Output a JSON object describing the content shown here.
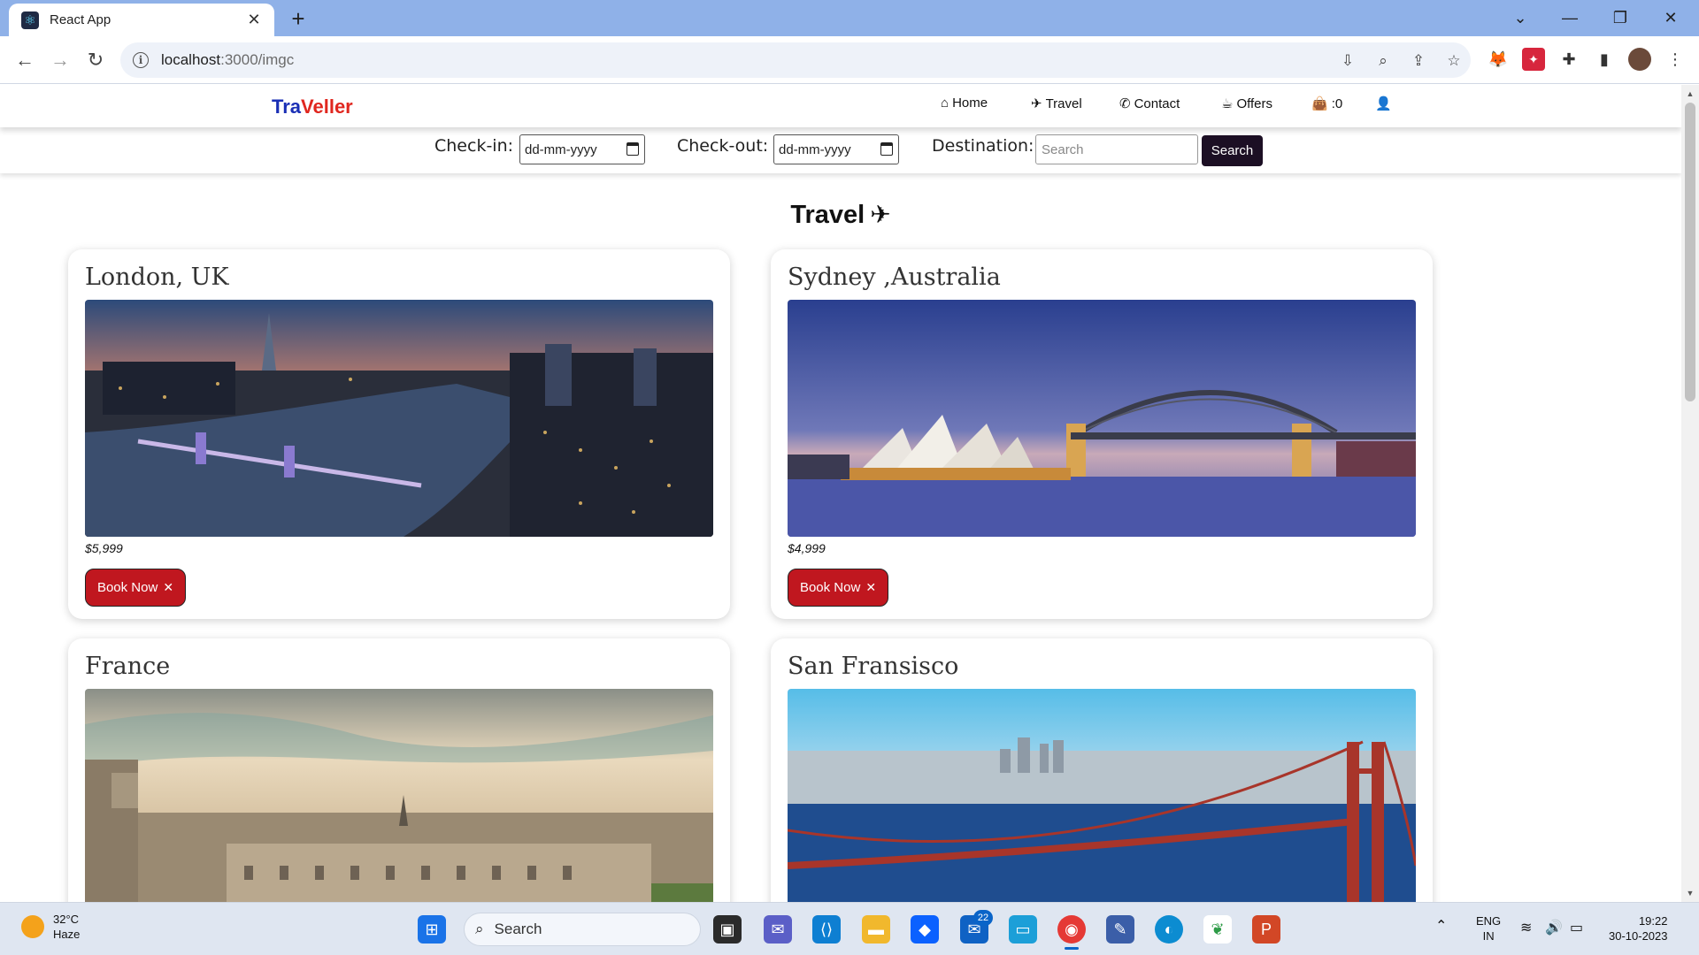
{
  "browser": {
    "tab_title": "React App",
    "url_host": "localhost",
    "url_path": ":3000/imgc"
  },
  "site": {
    "brand_part1": "Tra",
    "brand_part2": "Veller",
    "nav": {
      "home": "Home",
      "travel": "Travel",
      "contact": "Contact",
      "offers": "Offers",
      "cart_count": ":0"
    }
  },
  "search_bar": {
    "checkin_label": "Check-in:",
    "checkin_value": "dd-mm-yyyy",
    "checkout_label": "Check-out:",
    "checkout_value": "dd-mm-yyyy",
    "destination_label": "Destination:",
    "destination_placeholder": "Search",
    "search_button": "Search"
  },
  "section": {
    "title": "Travel"
  },
  "cards": [
    {
      "title": "London, UK",
      "price": "$5,999",
      "button": "Book Now"
    },
    {
      "title": "Sydney ,Australia",
      "price": "$4,999",
      "button": "Book Now"
    },
    {
      "title": "France"
    },
    {
      "title": "San Fransisco"
    }
  ],
  "taskbar": {
    "weather_temp": "32°C",
    "weather_desc": "Haze",
    "search_label": "Search",
    "mail_badge": "22",
    "lang_line1": "ENG",
    "lang_line2": "IN",
    "time": "19:22",
    "date": "30-10-2023"
  },
  "colors": {
    "brand_blue": "#1a2fb5",
    "brand_red": "#e0271f",
    "book_button": "#c0171f",
    "search_button": "#1c0f24"
  }
}
